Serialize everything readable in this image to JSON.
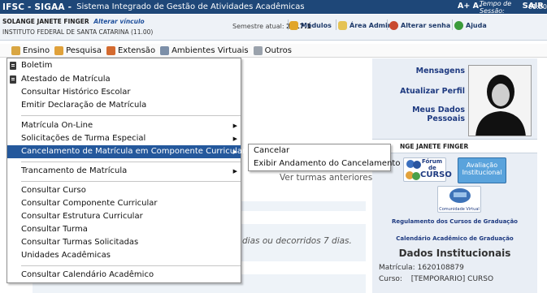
{
  "topbar": {
    "system": "IFSC - SIGAA -",
    "system_name": "Sistema Integrado de Gestão de Atividades Acadêmicas",
    "font_controls": "A+ A-",
    "session_label": "Tempo de Sessão:",
    "session_time": "01:20",
    "logout": "SAIR"
  },
  "infobar": {
    "user_name": "SOLANGE JANETE FINGER",
    "change_link": "Alterar vínculo",
    "institution": "INSTITUTO FEDERAL DE SANTA CATARINA (11.00)",
    "semester_label": "Semestre atual:",
    "semester_value": "2017.1",
    "links": [
      "Módulos",
      "Área Admin.",
      "Alterar senha",
      "Ajuda"
    ]
  },
  "menubar": {
    "items": [
      "Ensino",
      "Pesquisa",
      "Extensão",
      "Ambientes Virtuais",
      "Outros"
    ]
  },
  "dropdown": {
    "items": [
      "Boletim",
      "Atestado de Matrícula",
      "Consultar Histórico Escolar",
      "Emitir Declaração de Matrícula",
      "Matrícula On-Line",
      "Solicitações de Turma Especial",
      "Cancelamento de Matrícula em Componente Curricular",
      "Trancamento de Matrícula",
      "Consultar Curso",
      "Consultar Componente Curricular",
      "Consultar Estrutura Curricular",
      "Consultar Turma",
      "Consultar Turmas Solicitadas",
      "Unidades Acadêmicas",
      "Consultar Calendário Acadêmico"
    ],
    "submenu": [
      "Cancelar",
      "Exibir Andamento do Cancelamento"
    ]
  },
  "background": {
    "partial_text_1": "Ver turmas anteriores",
    "partial_text_2": "dias ou decorridos 7 dias."
  },
  "right_panel": {
    "links": [
      "Mensagens",
      "Atualizar Perfil",
      "Meus Dados Pessoais"
    ],
    "name_partial": "NGE JANETE FINGER",
    "forum_label_1": "Fórum",
    "forum_label_2": "de",
    "forum_label_3": "CURSO",
    "avaliacao_1": "Avaliação",
    "avaliacao_2": "Institucional",
    "comunidade": "Comunidade Virtual",
    "regulamento": "Regulamento dos Cursos de Graduação",
    "calendario": "Calendário Acadêmico de Graduação",
    "dados_title": "Dados Institucionais",
    "matricula_label": "Matrícula:",
    "matricula_value": "1620108879",
    "curso_label": "Curso:",
    "curso_value": "[TEMPORARIO] CURSO"
  },
  "colors": {
    "header_blue": "#1e4778",
    "highlight_blue": "#24589c",
    "panel_bg": "#e9eef5"
  }
}
